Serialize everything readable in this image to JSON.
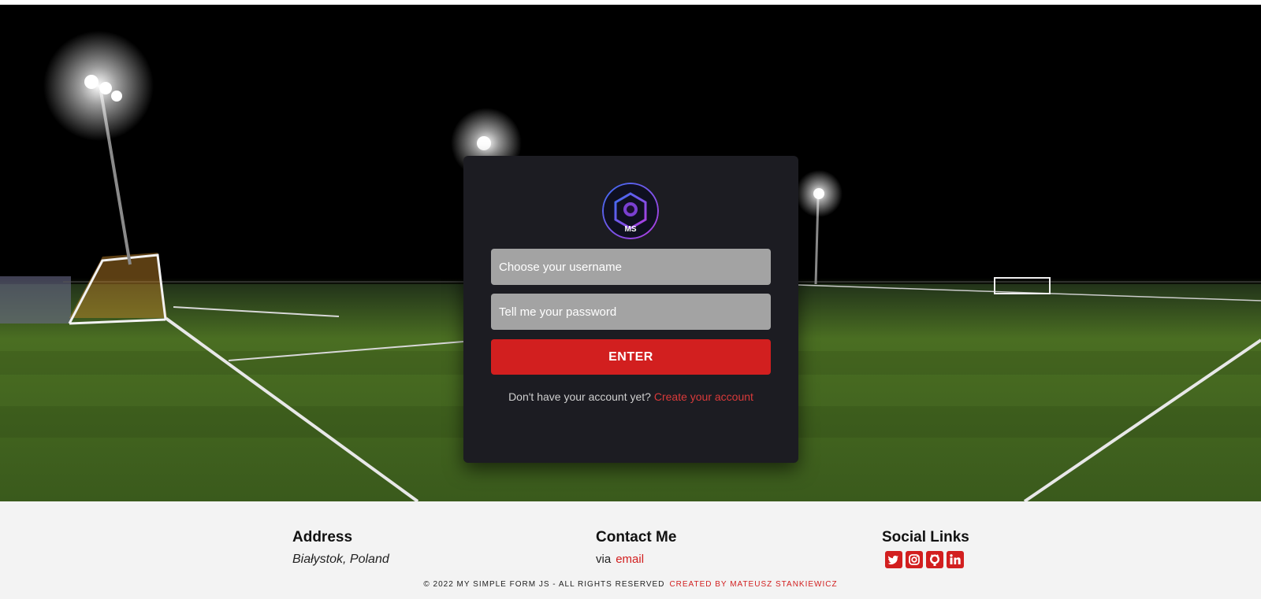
{
  "login": {
    "logo_text": "MS",
    "username_placeholder": "Choose your username",
    "password_placeholder": "Tell me your password",
    "enter_label": "ENTER",
    "signup_prompt": "Don't have your account yet?",
    "signup_link": "Create your account"
  },
  "footer": {
    "address": {
      "heading": "Address",
      "value": "Białystok, Poland"
    },
    "contact": {
      "heading": "Contact Me",
      "prefix": "via",
      "link": "email"
    },
    "social": {
      "heading": "Social Links",
      "icons": [
        "twitter-icon",
        "instagram-icon",
        "github-icon",
        "linkedin-icon"
      ]
    },
    "copyright": "© 2022 MY SIMPLE FORM JS - ALL RIGHTS RESERVED",
    "author": "CREATED BY MATEUSZ STANKIEWICZ"
  },
  "colors": {
    "accent": "#d21f1f",
    "card": "#1c1c22",
    "field": "#a3a3a3",
    "footer": "#f3f3f3"
  }
}
